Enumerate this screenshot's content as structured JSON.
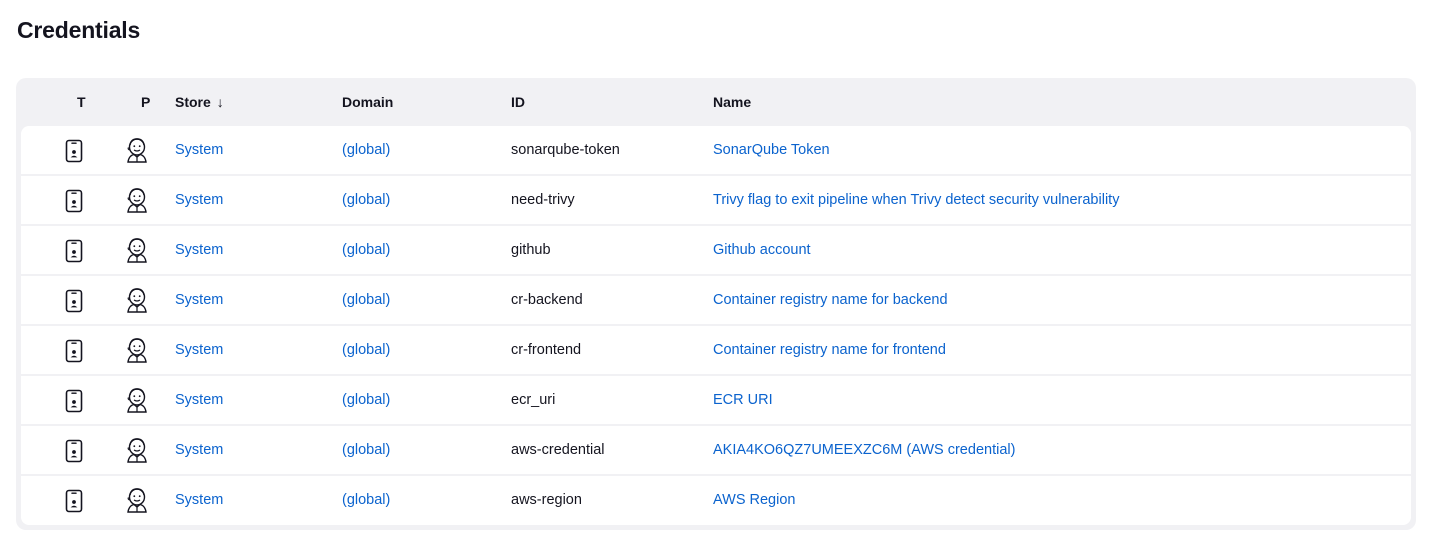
{
  "page": {
    "title": "Credentials"
  },
  "table": {
    "columns": {
      "t": "T",
      "p": "P",
      "store": "Store",
      "domain": "Domain",
      "id": "ID",
      "name": "Name"
    },
    "sort": {
      "column": "store",
      "direction_icon": "arrow-down-icon",
      "glyph": "↓"
    },
    "rows": [
      {
        "type_icon": "mobile-credential-icon",
        "provider_icon": "jenkins-icon",
        "store": "System",
        "domain": "(global)",
        "id": "sonarqube-token",
        "name": "SonarQube Token"
      },
      {
        "type_icon": "mobile-credential-icon",
        "provider_icon": "jenkins-icon",
        "store": "System",
        "domain": "(global)",
        "id": "need-trivy",
        "name": "Trivy flag to exit pipeline when Trivy detect security vulnerability"
      },
      {
        "type_icon": "mobile-credential-icon",
        "provider_icon": "jenkins-icon",
        "store": "System",
        "domain": "(global)",
        "id": "github",
        "name": "Github account"
      },
      {
        "type_icon": "mobile-credential-icon",
        "provider_icon": "jenkins-icon",
        "store": "System",
        "domain": "(global)",
        "id": "cr-backend",
        "name": "Container registry name for backend"
      },
      {
        "type_icon": "mobile-credential-icon",
        "provider_icon": "jenkins-icon",
        "store": "System",
        "domain": "(global)",
        "id": "cr-frontend",
        "name": "Container registry name for frontend"
      },
      {
        "type_icon": "mobile-credential-icon",
        "provider_icon": "jenkins-icon",
        "store": "System",
        "domain": "(global)",
        "id": "ecr_uri",
        "name": "ECR URI"
      },
      {
        "type_icon": "mobile-credential-icon",
        "provider_icon": "jenkins-icon",
        "store": "System",
        "domain": "(global)",
        "id": "aws-credential",
        "name": "AKIA4KO6QZ7UMEEXZC6M (AWS credential)"
      },
      {
        "type_icon": "mobile-credential-icon",
        "provider_icon": "jenkins-icon",
        "store": "System",
        "domain": "(global)",
        "id": "aws-region",
        "name": "AWS Region"
      }
    ]
  },
  "colors": {
    "link": "#0b63ce",
    "table_bg": "#f1f1f4",
    "text": "#14141f"
  }
}
